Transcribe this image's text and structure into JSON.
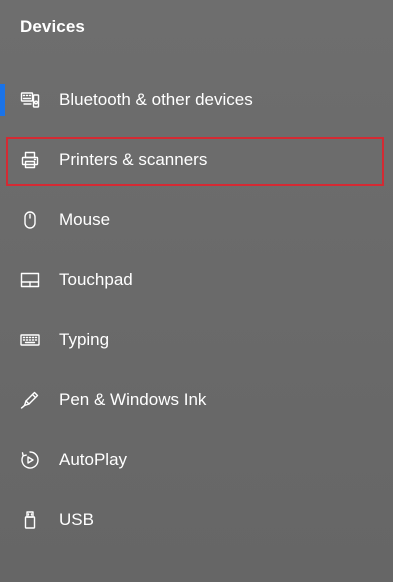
{
  "section": {
    "title": "Devices"
  },
  "nav": {
    "items": [
      {
        "label": "Bluetooth & other devices",
        "icon": "bluetooth-devices-icon",
        "active": true
      },
      {
        "label": "Printers & scanners",
        "icon": "printer-icon",
        "active": false,
        "highlighted": true
      },
      {
        "label": "Mouse",
        "icon": "mouse-icon",
        "active": false
      },
      {
        "label": "Touchpad",
        "icon": "touchpad-icon",
        "active": false
      },
      {
        "label": "Typing",
        "icon": "keyboard-icon",
        "active": false
      },
      {
        "label": "Pen & Windows Ink",
        "icon": "pen-icon",
        "active": false
      },
      {
        "label": "AutoPlay",
        "icon": "autoplay-icon",
        "active": false
      },
      {
        "label": "USB",
        "icon": "usb-icon",
        "active": false
      }
    ]
  },
  "colors": {
    "background": "#6b6b6b",
    "text": "#ffffff",
    "active_indicator": "#1a73e8",
    "highlight_border": "#d42a33"
  }
}
